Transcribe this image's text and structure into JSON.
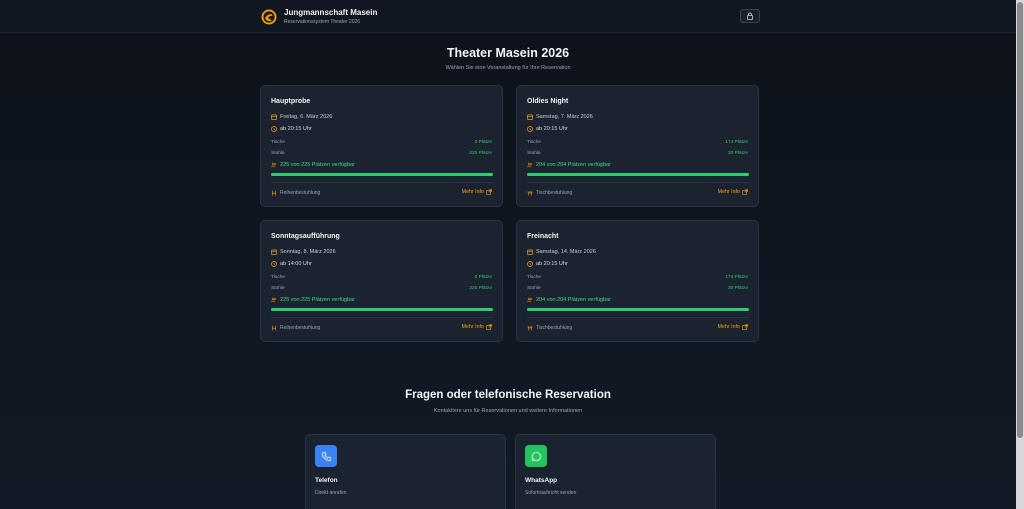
{
  "header": {
    "title": "Jungmannschaft Masein",
    "subtitle": "Reservationssystem Theater 2026"
  },
  "main": {
    "title": "Theater Masein 2026",
    "subtitle": "Wählen Sie eine Veranstaltung für Ihre Reservation"
  },
  "events": [
    {
      "title": "Hauptprobe",
      "date": "Freitag, 6. März 2026",
      "time": "ab 20:15 Uhr",
      "tables_label": "Tische",
      "tables_value": "0 Plätze",
      "chairs_label": "Stühle",
      "chairs_value": "225 Plätze",
      "availability": "225 von 225 Plätzen verfügbar",
      "available_fraction": 1.0,
      "seating": "Reihenbestuhlung",
      "more": "Mehr Info"
    },
    {
      "title": "Oldies Night",
      "date": "Samstag, 7. März 2026",
      "time": "ab 20:15 Uhr",
      "tables_label": "Tische",
      "tables_value": "174 Plätze",
      "chairs_label": "Stühle",
      "chairs_value": "30 Plätze",
      "availability": "204 von 204 Plätzen verfügbar",
      "available_fraction": 1.0,
      "seating": "Tischbestuhlung",
      "more": "Mehr Info"
    },
    {
      "title": "Sonntagsaufführung",
      "date": "Sonntag, 8. März 2026",
      "time": "ab 14:00 Uhr",
      "tables_label": "Tische",
      "tables_value": "0 Plätze",
      "chairs_label": "Stühle",
      "chairs_value": "225 Plätze",
      "availability": "225 von 225 Plätzen verfügbar",
      "available_fraction": 1.0,
      "seating": "Reihenbestuhlung",
      "more": "Mehr Info"
    },
    {
      "title": "Freinacht",
      "date": "Samstag, 14. März 2026",
      "time": "ab 20:15 Uhr",
      "tables_label": "Tische",
      "tables_value": "174 Plätze",
      "chairs_label": "Stühle",
      "chairs_value": "30 Plätze",
      "availability": "204 von 204 Plätzen verfügbar",
      "available_fraction": 1.0,
      "seating": "Tischbestuhlung",
      "more": "Mehr Info"
    }
  ],
  "contact": {
    "title": "Fragen oder telefonische Reservation",
    "subtitle": "Kontaktiere uns für Reservationen und weitere Informationen",
    "cards": [
      {
        "title": "Telefon",
        "subtitle": "Direkt anrufen",
        "icon": "phone-icon",
        "color": "#3b82f6"
      },
      {
        "title": "WhatsApp",
        "subtitle": "Sofortnachricht senden",
        "icon": "whatsapp-icon",
        "color": "#22c55e"
      }
    ]
  },
  "colors": {
    "background": "#0f141c",
    "card": "#1b2330",
    "accent": "#f59e0b",
    "success": "#2ecc71"
  }
}
